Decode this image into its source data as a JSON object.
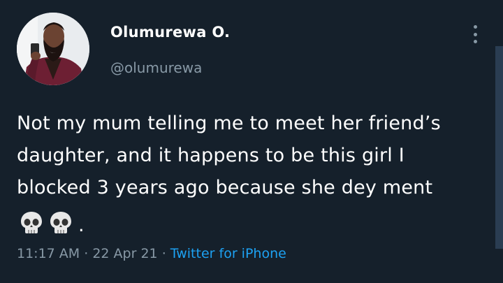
{
  "tweet": {
    "author": {
      "display_name": "Olumurewa O.",
      "handle": "@olumurewa",
      "avatar_icon": "profile-photo"
    },
    "text": "Not my mum telling me to meet her friend’s\ndaughter, and it happens to be this girl I\nblocked 3 years ago because she dey ment",
    "emojis": [
      "skull-icon",
      "skull-icon"
    ],
    "trailing_punctuation": ".",
    "time": "11:17 AM",
    "date": "22 Apr 21",
    "separator": "·",
    "source": "Twitter for iPhone",
    "menu_icon": "more-vertical-icon"
  },
  "colors": {
    "background": "#15202b",
    "primary_text": "#ffffff",
    "secondary_text": "#8899a6",
    "link": "#1da1f2"
  }
}
